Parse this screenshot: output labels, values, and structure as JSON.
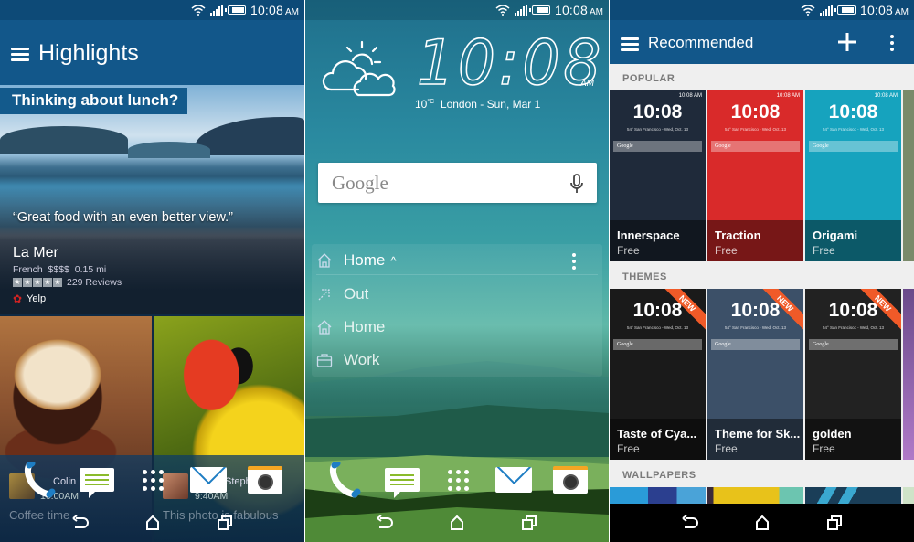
{
  "status_bar": {
    "time": "10:08",
    "ampm": "AM",
    "icons": [
      "wifi-icon",
      "signal-icon",
      "battery-icon"
    ]
  },
  "highlights": {
    "title": "Highlights",
    "menu_icon": "hamburger-menu-icon",
    "featured": {
      "tag": "Thinking about lunch?",
      "quote": "“Great food with an even better view.”",
      "place": "La Mer",
      "cuisine": "French",
      "price": "$$$$",
      "distance": "0.15 mi",
      "stars": 5,
      "reviews": "229 Reviews",
      "source": "Yelp"
    },
    "feed": [
      {
        "name": "Colin",
        "time": "10:00AM",
        "message": "Coffee time",
        "source_icon": "google-plus-icon"
      },
      {
        "name": "Stephanie",
        "time": "9:40AM",
        "message": "This photo is fabulous"
      }
    ]
  },
  "home": {
    "clock": "10:08",
    "ampm": "AM",
    "temperature": "10",
    "temp_unit": "°C",
    "weather_line": "London - Sun, Mar 1",
    "weather_icon": "partly-cloudy-icon",
    "search": {
      "label": "Google",
      "mic_icon": "microphone-icon"
    },
    "locations": [
      {
        "label": "Home",
        "icon": "home-icon",
        "current": true,
        "chevron": "^"
      },
      {
        "label": "Out",
        "icon": "rocket-icon"
      },
      {
        "label": "Home",
        "icon": "home-icon"
      },
      {
        "label": "Work",
        "icon": "briefcase-icon"
      }
    ]
  },
  "dock": [
    "phone-icon",
    "messages-icon",
    "app-drawer-icon",
    "mail-icon",
    "camera-icon"
  ],
  "nav": [
    "back-icon",
    "home-icon",
    "recents-icon"
  ],
  "recommended": {
    "title": "Recommended",
    "sections": [
      {
        "label": "POPULAR",
        "items": [
          {
            "name": "Innerspace",
            "price": "Free",
            "color": "#1f2a3a"
          },
          {
            "name": "Traction",
            "price": "Free",
            "color": "#d92a2a"
          },
          {
            "name": "Origami",
            "price": "Free",
            "color": "#16a3be"
          }
        ]
      },
      {
        "label": "THEMES",
        "items": [
          {
            "name": "Taste of Cya...",
            "price": "Free",
            "badge": "NEW",
            "color": "#1a1a1a"
          },
          {
            "name": "Theme for Sk...",
            "price": "Free",
            "badge": "NEW",
            "color": "#3c5068"
          },
          {
            "name": "golden",
            "price": "Free",
            "badge": "NEW",
            "color": "#222222"
          }
        ]
      },
      {
        "label": "WALLPAPERS"
      }
    ],
    "mini_clock": "10:08",
    "mini_location": "54° San Francisco - Wed, Oct. 13",
    "mini_search": "Google",
    "mini_status": "10:08 AM"
  },
  "colors": {
    "appbar": "#12578a",
    "statusbar": "#0d4a77",
    "new_badge": "#f05a28"
  }
}
